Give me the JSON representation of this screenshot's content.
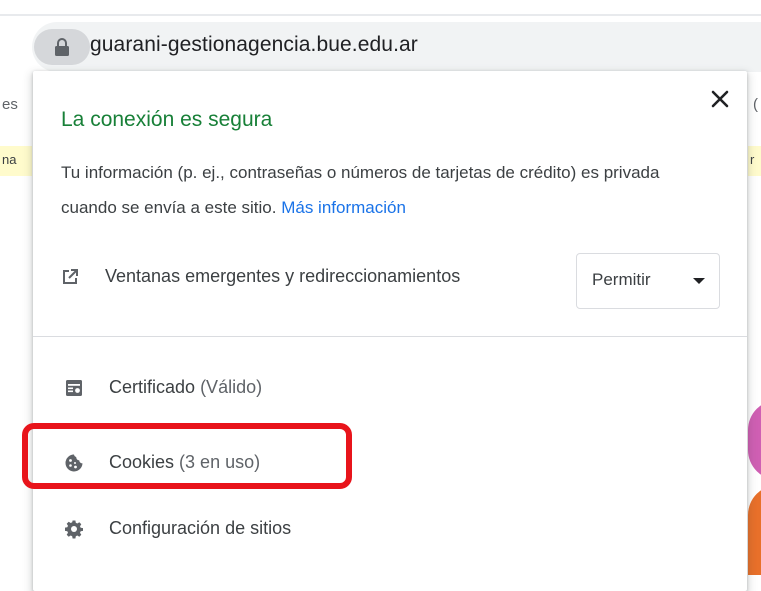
{
  "address_bar": {
    "url": "guarani-gestionagencia.bue.edu.ar",
    "lock_icon": "lock-icon"
  },
  "background": {
    "left_tab_fragment": "es",
    "right_tab_fragment": "(",
    "left_banner_fragment": "na",
    "right_banner_fragment": "r",
    "banner_color": "#fffbcc"
  },
  "popup": {
    "title": "La conexión es segura",
    "title_color": "#188038",
    "description": "Tu información (p. ej., contraseñas o números de tarjetas de crédito) es privada cuando se envía a este sitio.",
    "learn_more": "Más información",
    "link_color": "#1a73e8",
    "close_icon": "close-icon",
    "permission": {
      "icon": "open-in-new-icon",
      "label": "Ventanas emergentes y redireccionamientos",
      "value": "Permitir",
      "options": [
        "Permitir"
      ]
    },
    "items": [
      {
        "icon": "certificate-icon",
        "label": "Certificado",
        "sub": "(Válido)"
      },
      {
        "icon": "cookie-icon",
        "label": "Cookies",
        "sub": "(3 en uso)"
      },
      {
        "icon": "gear-icon",
        "label": "Configuración de sitios",
        "sub": ""
      }
    ]
  },
  "annotation": {
    "highlight_color": "#e8141b",
    "highlighted_item": "Cookies"
  }
}
